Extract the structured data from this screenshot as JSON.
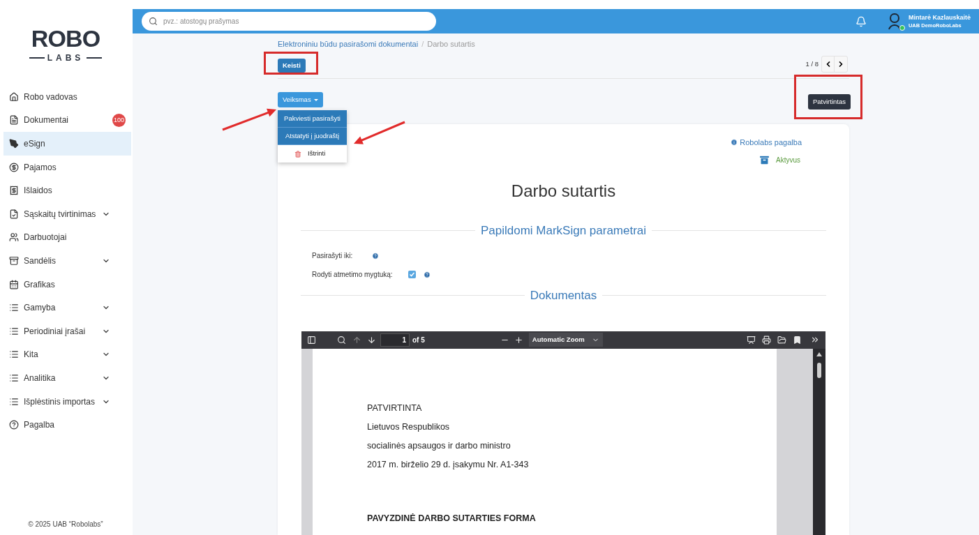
{
  "logo": {
    "top": "ROBO",
    "bottom": "LABS"
  },
  "sidebar": {
    "items": [
      {
        "label": "Robo vadovas",
        "selected": false,
        "expandable": false
      },
      {
        "label": "Dokumentai",
        "selected": false,
        "expandable": false,
        "badge": "100"
      },
      {
        "label": "eSign",
        "selected": true,
        "expandable": false
      },
      {
        "label": "Pajamos",
        "selected": false,
        "expandable": false
      },
      {
        "label": "Išlaidos",
        "selected": false,
        "expandable": false
      },
      {
        "label": "Sąskaitų tvirtinimas",
        "selected": false,
        "expandable": true
      },
      {
        "label": "Darbuotojai",
        "selected": false,
        "expandable": false
      },
      {
        "label": "Sandėlis",
        "selected": false,
        "expandable": true
      },
      {
        "label": "Grafikas",
        "selected": false,
        "expandable": false
      },
      {
        "label": "Gamyba",
        "selected": false,
        "expandable": true
      },
      {
        "label": "Periodiniai įrašai",
        "selected": false,
        "expandable": true
      },
      {
        "label": "Kita",
        "selected": false,
        "expandable": true
      },
      {
        "label": "Analitika",
        "selected": false,
        "expandable": true
      },
      {
        "label": "Išplėstinis importas",
        "selected": false,
        "expandable": true
      },
      {
        "label": "Pagalba",
        "selected": false,
        "expandable": false
      }
    ],
    "footer": "© 2025 UAB “Robolabs”"
  },
  "header": {
    "search": {
      "placeholder": "pvz.: atostogų prašymas"
    },
    "user": {
      "name": "Mintarė Kazlauskaitė",
      "company": "UAB DemoRoboLabs",
      "online": true
    }
  },
  "breadcrumb_separator": "/",
  "breadcrumb": [
    {
      "label": "Elektroniniu būdu pasirašomi dokumentai",
      "kind": "link"
    },
    {
      "label": "Darbo sutartis",
      "kind": "current"
    }
  ],
  "edit_button": "Keisti",
  "pager": {
    "text": "1 / 8"
  },
  "actions": {
    "label": "Veiksmas",
    "expanded": true,
    "items": [
      {
        "label": "Pakviesti pasirašyti",
        "kind": "action"
      },
      {
        "label": "Atstatyti į juodraštį",
        "kind": "action"
      },
      {
        "label": "Ištrinti",
        "kind": "delete"
      }
    ]
  },
  "status_button": "Patvirtintas",
  "card": {
    "help_link": "Robolabs pagalba",
    "state": "Aktyvus",
    "title": "Darbo sutartis",
    "params_heading": "Papildomi MarkSign parametrai",
    "fields": [
      {
        "label": "Pasirašyti iki:",
        "kind": "date"
      },
      {
        "label": "Rodyti atmetimo mygtuką:",
        "kind": "checkbox",
        "checked": true
      }
    ],
    "document_heading": "Dokumentas"
  },
  "pdf": {
    "page": "1",
    "page_count": "of 5",
    "zoom": "Automatic Zoom",
    "lines": [
      "PATVIRTINTA",
      "Lietuvos Respublikos",
      "socialinės apsaugos ir darbo ministro",
      "2017 m. birželio 29 d. įsakymu Nr. A1-343"
    ],
    "heading": "PAVYZDINĖ DARBO SUTARTIES FORMA"
  }
}
